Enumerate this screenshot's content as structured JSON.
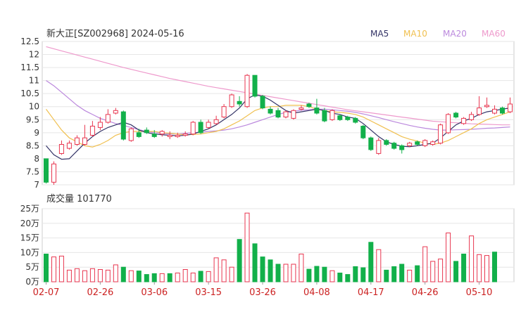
{
  "header": {
    "title": "新大正[SZ002968] 2024-05-16",
    "legend": [
      {
        "label": "MA5",
        "color": "#333366"
      },
      {
        "label": "MA10",
        "color": "#f0c050"
      },
      {
        "label": "MA20",
        "color": "#bb88dd"
      },
      {
        "label": "MA60",
        "color": "#ee99cc"
      }
    ]
  },
  "volume_header": {
    "label": "成交量 101770"
  },
  "colors": {
    "up": "#e8364f",
    "down": "#12b04a",
    "grid": "#e6e6e6",
    "axis_text": "#333333",
    "date_text": "#cc2222"
  },
  "chart_data": [
    {
      "type": "candlestick",
      "ylim": [
        7,
        12.5
      ],
      "yticks": [
        "12.5",
        "12",
        "11.5",
        "11",
        "10.5",
        "10",
        "9.5",
        "9",
        "8.5",
        "8",
        "7.5",
        "7"
      ],
      "categories": [
        "02-07",
        "02-08",
        "02-19",
        "02-20",
        "02-21",
        "02-22",
        "02-23",
        "02-26",
        "02-27",
        "02-28",
        "02-29",
        "03-01",
        "03-04",
        "03-05",
        "03-06",
        "03-07",
        "03-08",
        "03-11",
        "03-12",
        "03-13",
        "03-14",
        "03-15",
        "03-18",
        "03-19",
        "03-20",
        "03-21",
        "03-22",
        "03-25",
        "03-26",
        "03-27",
        "03-28",
        "03-29",
        "04-01",
        "04-02",
        "04-03",
        "04-08",
        "04-09",
        "04-10",
        "04-11",
        "04-12",
        "04-15",
        "04-16",
        "04-17",
        "04-18",
        "04-19",
        "04-22",
        "04-23",
        "04-24",
        "04-25",
        "04-26",
        "04-29",
        "04-30",
        "05-06",
        "05-07",
        "05-08",
        "05-09",
        "05-10",
        "05-13",
        "05-14",
        "05-15",
        "05-16"
      ],
      "xticks": [
        "02-07",
        "02-26",
        "03-06",
        "03-15",
        "03-26",
        "04-08",
        "04-17",
        "04-26",
        "05-10"
      ],
      "open": [
        8.0,
        7.1,
        8.2,
        8.4,
        8.55,
        8.55,
        8.9,
        9.2,
        9.4,
        9.75,
        9.8,
        8.7,
        9.0,
        9.1,
        8.95,
        8.95,
        8.85,
        8.85,
        8.9,
        8.95,
        9.4,
        9.2,
        9.35,
        9.6,
        10.0,
        10.2,
        10.0,
        11.2,
        10.4,
        9.9,
        9.85,
        9.6,
        9.55,
        9.9,
        10.1,
        9.95,
        9.85,
        9.5,
        9.65,
        9.6,
        9.55,
        9.25,
        8.8,
        8.2,
        8.7,
        8.6,
        8.5,
        8.5,
        8.65,
        8.5,
        8.55,
        8.6,
        9.0,
        9.75,
        9.35,
        9.5,
        9.7,
        10.0,
        9.75,
        9.95,
        9.8
      ],
      "close": [
        7.1,
        7.8,
        8.55,
        8.6,
        8.8,
        8.8,
        9.25,
        9.4,
        9.7,
        9.85,
        8.75,
        9.15,
        8.85,
        9.0,
        8.85,
        9.05,
        8.9,
        8.9,
        8.95,
        9.4,
        9.0,
        9.4,
        9.5,
        10.0,
        10.45,
        10.1,
        11.2,
        10.4,
        9.95,
        9.75,
        9.6,
        9.8,
        9.85,
        9.95,
        10.0,
        9.75,
        9.45,
        9.85,
        9.5,
        9.5,
        9.4,
        8.8,
        8.35,
        8.7,
        8.55,
        8.4,
        8.35,
        8.6,
        8.55,
        8.7,
        8.65,
        9.3,
        9.7,
        9.6,
        9.55,
        9.7,
        9.95,
        10.05,
        9.9,
        9.75,
        10.1
      ],
      "high": [
        8.0,
        7.9,
        8.7,
        8.7,
        8.9,
        9.3,
        9.45,
        9.6,
        9.9,
        9.95,
        9.85,
        9.2,
        9.15,
        9.2,
        9.1,
        9.1,
        9.05,
        9.0,
        9.05,
        9.45,
        9.5,
        9.5,
        9.65,
        10.1,
        10.5,
        10.4,
        11.25,
        11.2,
        10.45,
        10.0,
        9.95,
        9.85,
        9.9,
        10.05,
        10.15,
        10.3,
        9.95,
        9.9,
        9.7,
        9.65,
        9.6,
        9.3,
        8.85,
        8.8,
        8.75,
        8.65,
        8.55,
        8.65,
        8.7,
        8.75,
        8.7,
        9.35,
        9.75,
        9.8,
        9.6,
        9.8,
        10.4,
        10.35,
        10.05,
        10.0,
        10.35
      ],
      "low": [
        7.05,
        7.0,
        8.15,
        8.35,
        8.5,
        8.5,
        8.85,
        9.1,
        9.35,
        9.7,
        8.7,
        8.65,
        8.8,
        8.95,
        8.8,
        8.85,
        8.75,
        8.8,
        8.85,
        8.9,
        8.95,
        9.15,
        9.3,
        9.55,
        9.95,
        10.0,
        9.95,
        10.35,
        9.9,
        9.7,
        9.55,
        9.55,
        9.5,
        9.85,
        9.95,
        9.7,
        9.4,
        9.45,
        9.45,
        9.45,
        9.35,
        8.75,
        8.3,
        8.15,
        8.5,
        8.35,
        8.2,
        8.45,
        8.5,
        8.45,
        8.5,
        8.55,
        8.95,
        9.55,
        9.3,
        9.45,
        9.65,
        9.95,
        9.7,
        9.7,
        9.75
      ],
      "ma5": [
        8.5,
        8.15,
        7.98,
        8.0,
        8.3,
        8.6,
        8.85,
        9.05,
        9.2,
        9.3,
        9.4,
        9.3,
        9.1,
        9.0,
        8.95,
        8.92,
        8.9,
        8.88,
        8.9,
        8.95,
        9.05,
        9.15,
        9.3,
        9.5,
        9.7,
        9.95,
        10.3,
        10.45,
        10.4,
        10.25,
        10.05,
        9.85,
        9.75,
        9.8,
        9.85,
        9.9,
        9.85,
        9.75,
        9.7,
        9.6,
        9.55,
        9.35,
        9.1,
        8.85,
        8.65,
        8.55,
        8.48,
        8.46,
        8.5,
        8.55,
        8.6,
        8.8,
        9.05,
        9.3,
        9.45,
        9.55,
        9.7,
        9.8,
        9.85,
        9.9,
        9.95
      ],
      "ma10": [
        9.9,
        9.5,
        9.1,
        8.8,
        8.65,
        8.5,
        8.45,
        8.55,
        8.7,
        8.9,
        9.0,
        9.05,
        9.05,
        9.05,
        9.05,
        9.0,
        8.98,
        8.95,
        8.92,
        8.93,
        8.95,
        9.0,
        9.05,
        9.15,
        9.3,
        9.45,
        9.65,
        9.85,
        9.95,
        10.0,
        10.0,
        10.05,
        10.05,
        10.05,
        10.0,
        9.9,
        9.85,
        9.8,
        9.78,
        9.75,
        9.7,
        9.6,
        9.45,
        9.3,
        9.15,
        9.0,
        8.85,
        8.75,
        8.68,
        8.6,
        8.55,
        8.6,
        8.7,
        8.85,
        9.0,
        9.15,
        9.35,
        9.5,
        9.6,
        9.7,
        9.8
      ],
      "ma20": [
        11.0,
        10.8,
        10.55,
        10.3,
        10.05,
        9.85,
        9.7,
        9.55,
        9.45,
        9.35,
        9.28,
        9.2,
        9.12,
        9.05,
        9.0,
        8.97,
        8.95,
        8.95,
        8.97,
        9.0,
        9.02,
        9.05,
        9.07,
        9.1,
        9.15,
        9.22,
        9.3,
        9.4,
        9.5,
        9.6,
        9.7,
        9.78,
        9.82,
        9.86,
        9.88,
        9.9,
        9.9,
        9.88,
        9.85,
        9.82,
        9.78,
        9.72,
        9.65,
        9.58,
        9.5,
        9.42,
        9.35,
        9.28,
        9.22,
        9.17,
        9.13,
        9.1,
        9.1,
        9.11,
        9.12,
        9.13,
        9.15,
        9.17,
        9.18,
        9.2,
        9.22
      ],
      "ma60": [
        12.3,
        12.22,
        12.14,
        12.06,
        11.98,
        11.9,
        11.82,
        11.74,
        11.66,
        11.58,
        11.5,
        11.43,
        11.36,
        11.29,
        11.22,
        11.15,
        11.08,
        11.02,
        10.96,
        10.9,
        10.84,
        10.78,
        10.73,
        10.68,
        10.63,
        10.58,
        10.53,
        10.48,
        10.43,
        10.38,
        10.33,
        10.28,
        10.23,
        10.18,
        10.13,
        10.08,
        10.03,
        9.98,
        9.93,
        9.88,
        9.84,
        9.8,
        9.76,
        9.72,
        9.68,
        9.64,
        9.6,
        9.56,
        9.52,
        9.48,
        9.44,
        9.42,
        9.4,
        9.38,
        9.36,
        9.34,
        9.33,
        9.32,
        9.31,
        9.3,
        9.3
      ]
    },
    {
      "type": "bar",
      "title": "成交量",
      "ylim": [
        0,
        250000
      ],
      "yticks": [
        "25万",
        "20万",
        "15万",
        "10万",
        "5万",
        "0万"
      ],
      "categories_ref": "same as candlestick",
      "values": [
        95000,
        85000,
        88000,
        40000,
        45000,
        38000,
        45000,
        42000,
        40000,
        58000,
        50000,
        38000,
        37000,
        25000,
        28000,
        28000,
        28000,
        30000,
        42000,
        30000,
        36000,
        35000,
        82000,
        75000,
        50000,
        145000,
        235000,
        130000,
        85000,
        75000,
        60000,
        60000,
        60000,
        95000,
        43000,
        53000,
        50000,
        38000,
        30000,
        25000,
        52000,
        48000,
        135000,
        110000,
        40000,
        52000,
        60000,
        40000,
        55000,
        120000,
        70000,
        78000,
        167000,
        70000,
        95000,
        157000,
        93000,
        90000,
        101770
      ],
      "direction": [
        "down",
        "up",
        "up",
        "up",
        "up",
        "up",
        "up",
        "up",
        "up",
        "up",
        "down",
        "up",
        "down",
        "down",
        "down",
        "up",
        "down",
        "up",
        "up",
        "up",
        "down",
        "up",
        "up",
        "up",
        "up",
        "down",
        "up",
        "down",
        "down",
        "down",
        "down",
        "up",
        "up",
        "up",
        "down",
        "down",
        "down",
        "up",
        "down",
        "down",
        "down",
        "down",
        "down",
        "up",
        "down",
        "down",
        "down",
        "up",
        "down",
        "up",
        "up",
        "up",
        "up",
        "down",
        "down",
        "up",
        "up",
        "up",
        "down",
        "down",
        "up"
      ]
    }
  ]
}
